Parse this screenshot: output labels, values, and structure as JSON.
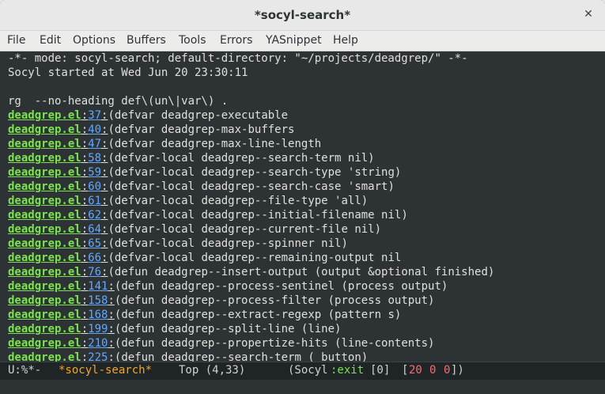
{
  "window": {
    "title": "*socyl-search*",
    "close_glyph": "✕"
  },
  "menu": [
    "File",
    "Edit",
    "Options",
    "Buffers",
    "Tools",
    "Errors",
    "YASnippet",
    "Help"
  ],
  "header_lines": [
    "-*- mode: socyl-search; default-directory: \"~/projects/deadgrep/\" -*-",
    "Socyl started at Wed Jun 20 23:30:11",
    "",
    "rg  --no-heading def\\(un\\|var\\) ."
  ],
  "results": [
    {
      "file": "deadgrep.el",
      "line": "37",
      "text": "(defvar deadgrep-executable"
    },
    {
      "file": "deadgrep.el",
      "line": "40",
      "text": "(defvar deadgrep-max-buffers"
    },
    {
      "file": "deadgrep.el",
      "line": "47",
      "text": "(defvar deadgrep-max-line-length"
    },
    {
      "file": "deadgrep.el",
      "line": "58",
      "text": "(defvar-local deadgrep--search-term nil)"
    },
    {
      "file": "deadgrep.el",
      "line": "59",
      "text": "(defvar-local deadgrep--search-type 'string)"
    },
    {
      "file": "deadgrep.el",
      "line": "60",
      "text": "(defvar-local deadgrep--search-case 'smart)"
    },
    {
      "file": "deadgrep.el",
      "line": "61",
      "text": "(defvar-local deadgrep--file-type 'all)"
    },
    {
      "file": "deadgrep.el",
      "line": "62",
      "text": "(defvar-local deadgrep--initial-filename nil)"
    },
    {
      "file": "deadgrep.el",
      "line": "64",
      "text": "(defvar-local deadgrep--current-file nil)"
    },
    {
      "file": "deadgrep.el",
      "line": "65",
      "text": "(defvar-local deadgrep--spinner nil)"
    },
    {
      "file": "deadgrep.el",
      "line": "66",
      "text": "(defvar-local deadgrep--remaining-output nil"
    },
    {
      "file": "deadgrep.el",
      "line": "76",
      "text": "(defun deadgrep--insert-output (output &optional finished)"
    },
    {
      "file": "deadgrep.el",
      "line": "141",
      "text": "(defun deadgrep--process-sentinel (process output)"
    },
    {
      "file": "deadgrep.el",
      "line": "158",
      "text": "(defun deadgrep--process-filter (process output)"
    },
    {
      "file": "deadgrep.el",
      "line": "168",
      "text": "(defun deadgrep--extract-regexp (pattern s)"
    },
    {
      "file": "deadgrep.el",
      "line": "199",
      "text": "(defun deadgrep--split-line (line)"
    },
    {
      "file": "deadgrep.el",
      "line": "210",
      "text": "(defun deadgrep--propertize-hits (line-contents)"
    },
    {
      "file": "deadgrep.el",
      "line": "225",
      "text": "(defun deadgrep--search-term ( button)"
    }
  ],
  "modeline": {
    "status": "U:%*-",
    "buffer": "*socyl-search*",
    "position": "Top (4,33)",
    "mode_open": "(Socyl",
    "mode_exit": ":exit",
    "exit_code": "[0]",
    "counts_open": "[",
    "count_a": "20",
    "count_b": "0",
    "count_c": "0",
    "counts_close": "])"
  },
  "colors": {
    "background": "#2d3235",
    "file_link": "#7ce24f",
    "line_number": "#62a8ff",
    "modeline_buffer": "#f6a623",
    "modeline_exit": "#7ce24f",
    "modeline_count": "#ff6b6b"
  }
}
